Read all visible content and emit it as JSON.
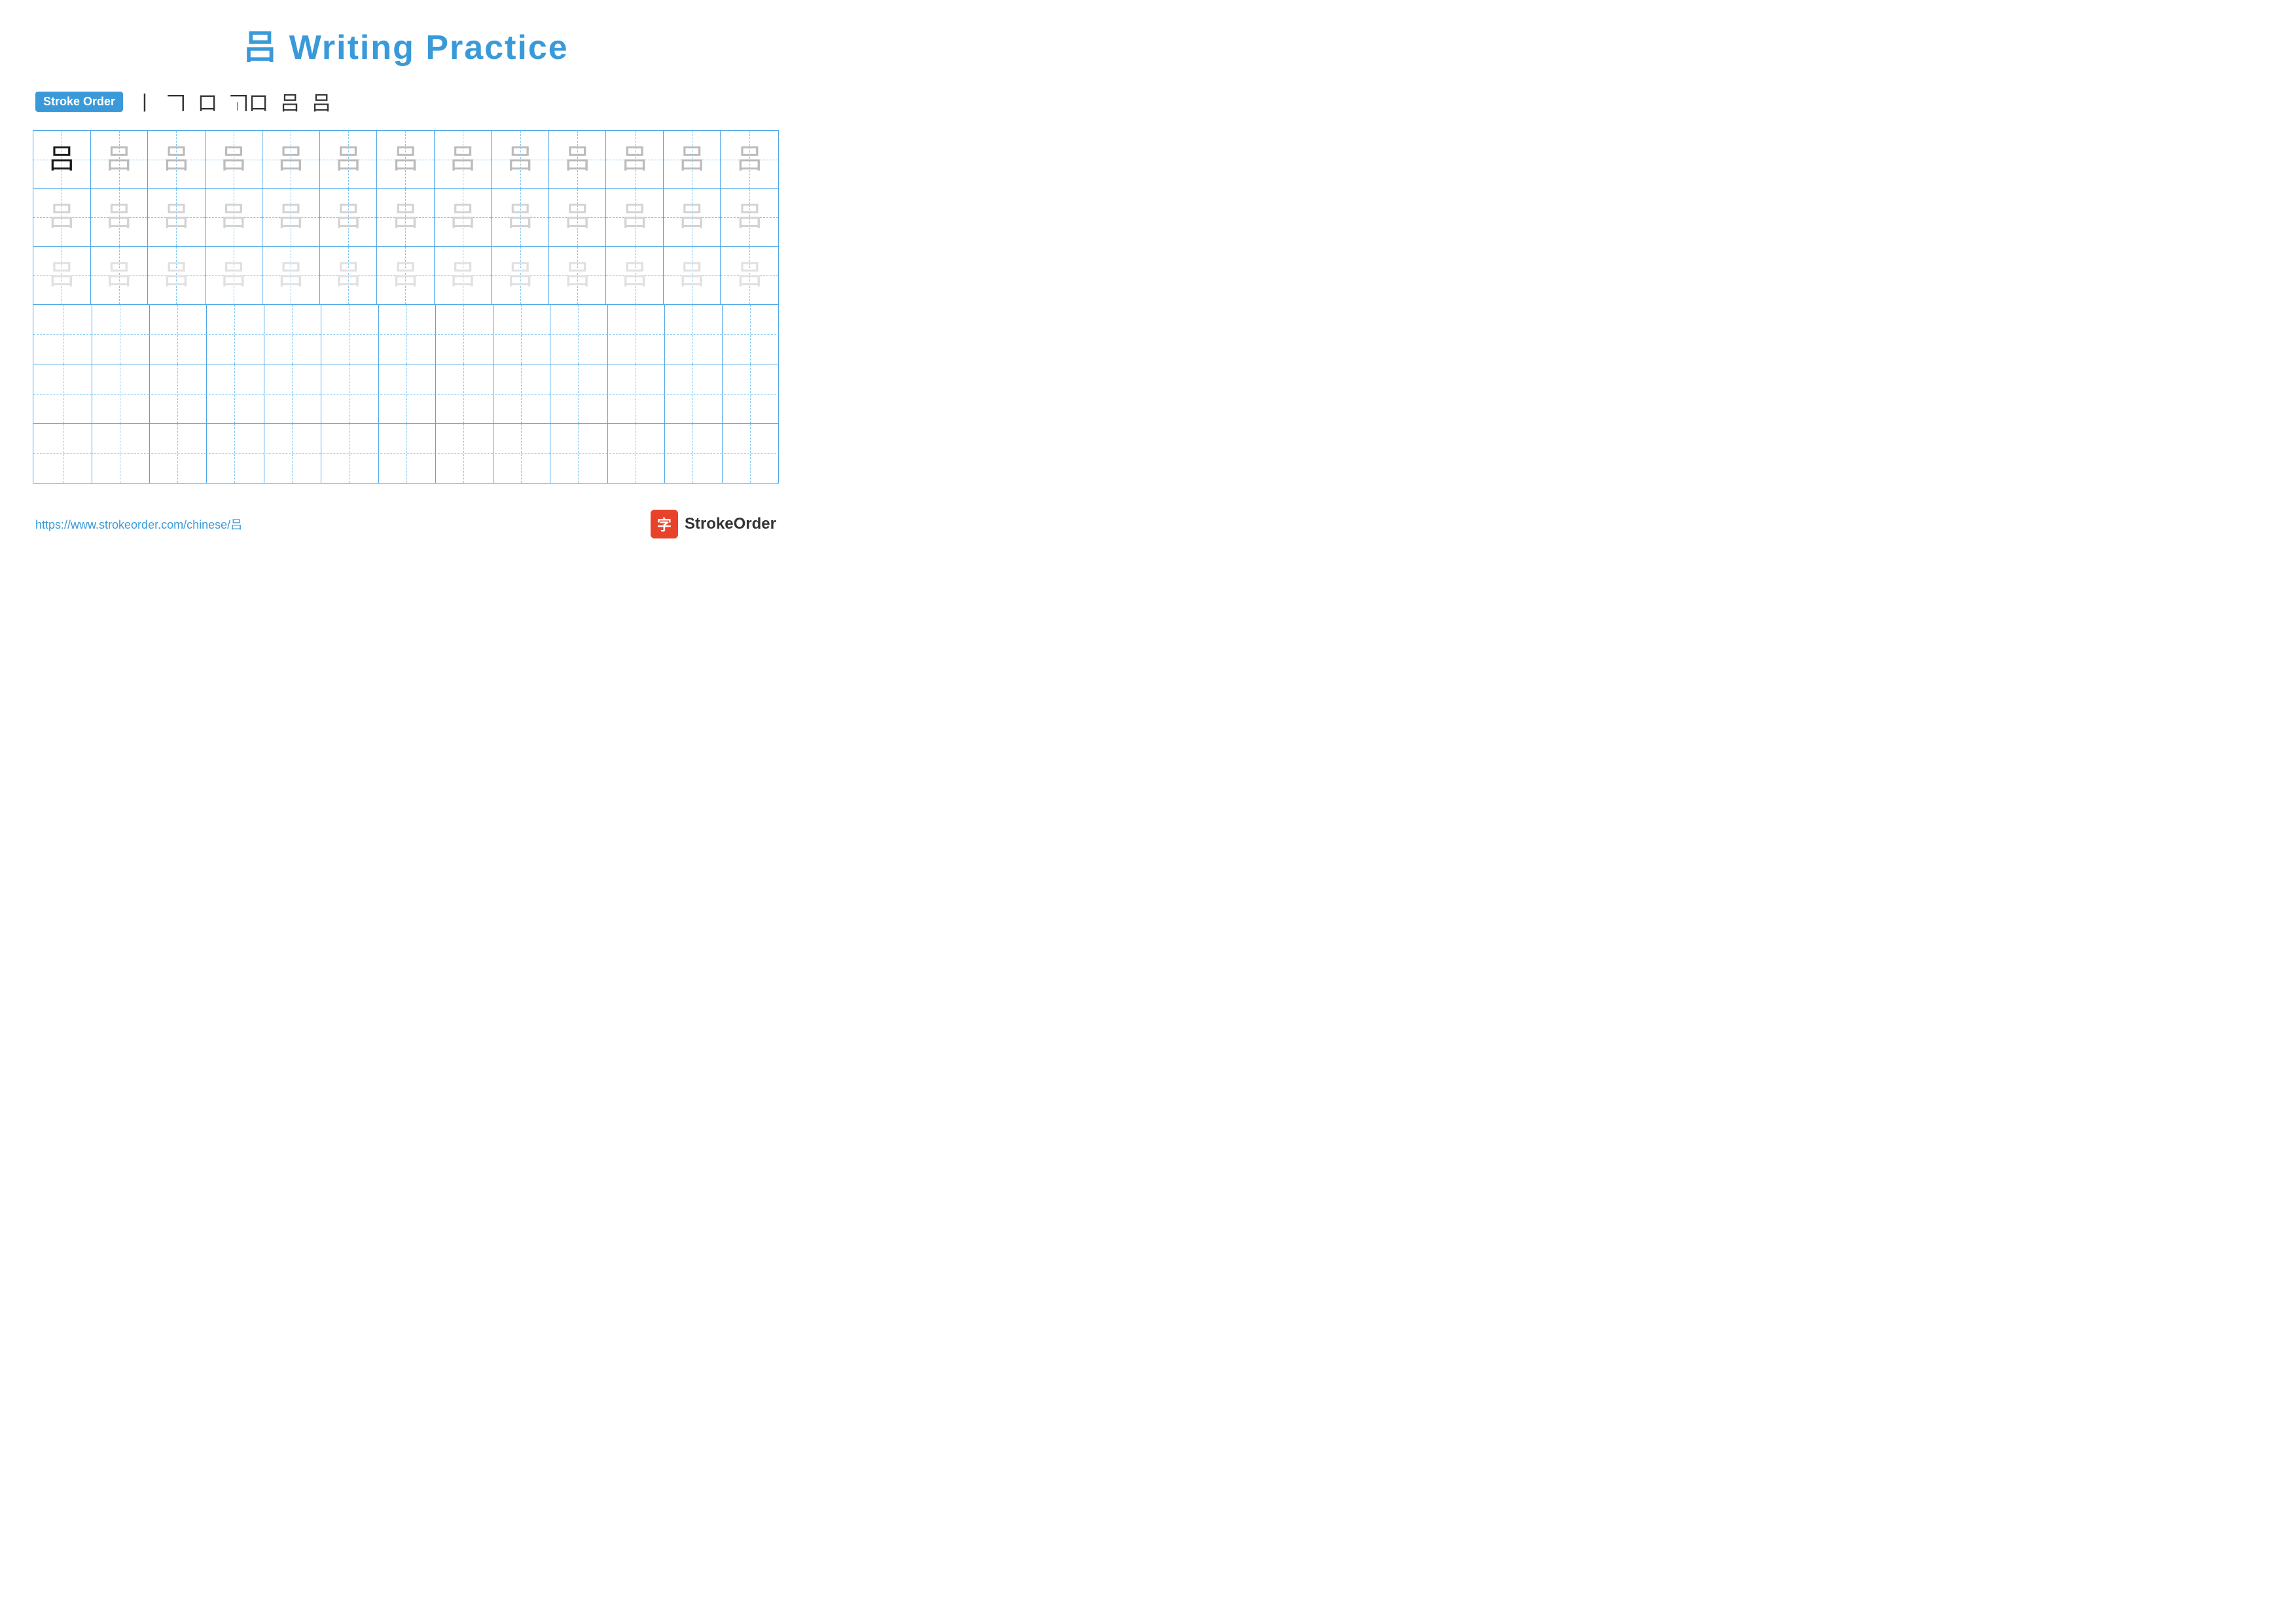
{
  "title": {
    "char": "吕",
    "text": "Writing Practice"
  },
  "stroke_order": {
    "badge_label": "Stroke Order",
    "steps": [
      "丨",
      "𠃍",
      "口",
      "𠃍口",
      "吕",
      "吕"
    ]
  },
  "grid": {
    "rows": 6,
    "cols": 13,
    "char": "吕"
  },
  "footer": {
    "url": "https://www.strokeorder.com/chinese/吕",
    "logo_char": "字",
    "logo_text": "StrokeOrder"
  }
}
